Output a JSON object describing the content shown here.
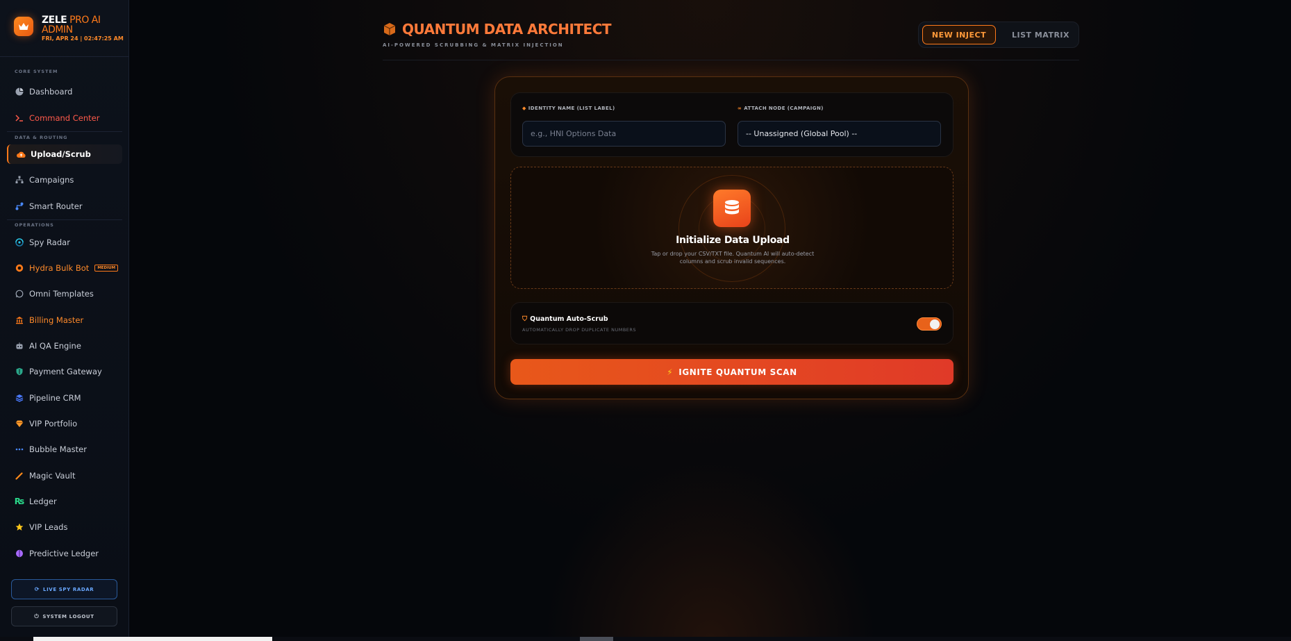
{
  "brand": {
    "name_white": "ZELE",
    "name_orange_1": " PRO AI",
    "name_orange_2": "ADMIN",
    "datetime": "FRI, APR 24 | 02:47:25 AM",
    "logo_icon": "crown-icon"
  },
  "sidebar": {
    "sections": {
      "core": "CORE SYSTEM",
      "data": "DATA & ROUTING",
      "ops": "OPERATIONS"
    },
    "items": [
      {
        "label": "Dashboard",
        "icon": "pie-chart-icon"
      },
      {
        "label": "Command Center",
        "icon": "terminal-icon"
      },
      {
        "label": "Upload/Scrub",
        "icon": "cloud-upload-icon"
      },
      {
        "label": "Campaigns",
        "icon": "sitemap-icon"
      },
      {
        "label": "Smart Router",
        "icon": "route-icon"
      },
      {
        "label": "Spy Radar",
        "icon": "radar-icon"
      },
      {
        "label": "Hydra Bulk Bot",
        "icon": "bot-icon",
        "tag": "MEDIUM"
      },
      {
        "label": "Omni Templates",
        "icon": "whatsapp-icon"
      },
      {
        "label": "Billing Master",
        "icon": "bank-icon"
      },
      {
        "label": "AI QA Engine",
        "icon": "robot-icon"
      },
      {
        "label": "Payment Gateway",
        "icon": "shield-icon"
      },
      {
        "label": "Pipeline CRM",
        "icon": "layers-icon"
      },
      {
        "label": "VIP Portfolio",
        "icon": "gem-icon"
      },
      {
        "label": "Bubble Master",
        "icon": "dots-icon"
      },
      {
        "label": "Magic Vault",
        "icon": "wand-icon"
      },
      {
        "label": "Ledger",
        "icon": "rupee-icon"
      },
      {
        "label": "VIP Leads",
        "icon": "star-icon"
      },
      {
        "label": "Predictive Ledger",
        "icon": "brain-icon"
      }
    ],
    "live_spy_radar": "LIVE SPY RADAR",
    "system_logout": "SYSTEM LOGOUT"
  },
  "header": {
    "title": "QUANTUM DATA ARCHITECT",
    "subtitle": "AI-POWERED SCRUBBING & MATRIX INJECTION",
    "tabs": [
      {
        "label": "NEW INJECT",
        "active": true
      },
      {
        "label": "LIST MATRIX",
        "active": false
      }
    ]
  },
  "form": {
    "identity_label": "IDENTITY NAME (LIST LABEL)",
    "identity_placeholder": "e.g., HNI Options Data",
    "attach_label": "ATTACH NODE (CAMPAIGN)",
    "attach_value": "-- Unassigned (Global Pool) --",
    "upload_title": "Initialize Data Upload",
    "upload_desc": "Tap or drop your CSV/TXT file. Quantum AI will auto-detect columns and scrub invalid sequences.",
    "scrub_title": "Quantum Auto-Scrub",
    "scrub_sub": "AUTOMATICALLY DROP DUPLICATE NUMBERS",
    "scrub_enabled": true,
    "ignite_label": "IGNITE QUANTUM SCAN"
  },
  "colors": {
    "accent": "#ff7a1a",
    "title": "#ff7a3a",
    "button_start": "#e8581a",
    "button_end": "#e03a28"
  }
}
